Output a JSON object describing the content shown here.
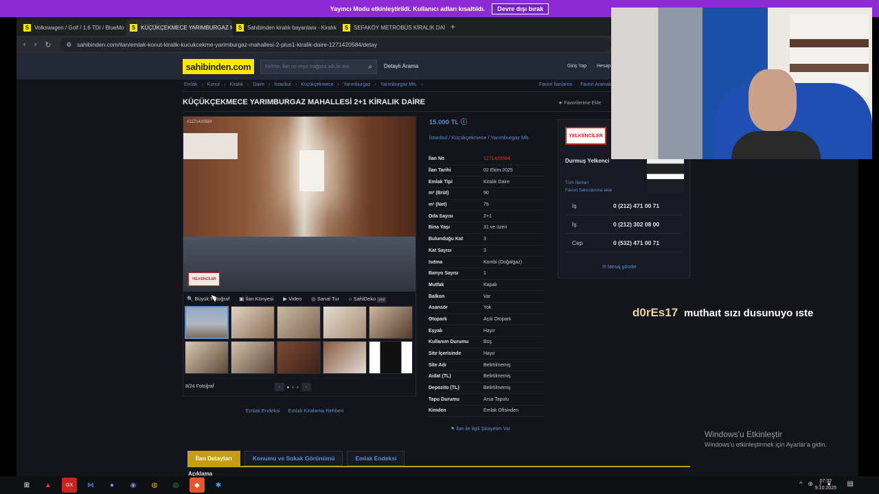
{
  "banner": {
    "text": "Yayıncı Modu etkinleştirildi. Kullanıcı adları kısaltıldı.",
    "button": "Devre dışı bırak"
  },
  "browser": {
    "tabs": [
      {
        "icon": "S",
        "title": "Volkswagen / Golf / 1.6 TDI / BlueMo"
      },
      {
        "icon": "S",
        "title": "KÜÇÜKÇEKMECE YARIMBURGAZ M"
      },
      {
        "icon": "S",
        "title": "Sahibinden kiralık bayanlara - Kiralık"
      },
      {
        "icon": "S",
        "title": "SEFAKÖY METROBÜS KİRALIK DAİRE"
      }
    ],
    "url": "sahibinden.com/ilan/emlak-konut-kiralik-kucukcekme-yarimburgaz-mahallesi-2-plus1-kiralik-daire-1271420584/detay"
  },
  "header": {
    "logo": "sahibinden.com",
    "search_placeholder": "Kelime, ilan no veya mağaza adı ile ara",
    "detailed_search": "Detaylı Arama",
    "login": "Giriş Yap",
    "account": "Hesap"
  },
  "breadcrumb": [
    "Emlak",
    "Konut",
    "Kiralık",
    "Daire",
    "İstanbul",
    "Küçükçekmece",
    "Yarımburgaz",
    "Yarımburgaz Mh."
  ],
  "fav_links": [
    "Favori İlanlarım",
    "Favori Aramalar"
  ],
  "listing": {
    "title": "KÜÇÜKÇEKMECE YARIMBURGAZ MAHALLESİ 2+1 KİRALIK DAİRE",
    "add_favorite": "Favorilerime Ekle",
    "photo_id": "#1271420584",
    "photo_stamp": "YELKENCİLER",
    "price": "15.000 TL",
    "location": "İstanbul / Küçükçekmece / Yarımburgaz Mh.",
    "media": [
      "Büyük Fotoğraf",
      "İlan Künyesi",
      "Video",
      "Sanal Tur",
      "SahiDeko"
    ],
    "media_new": "yeni",
    "photo_count": "8/24 Fotoğraf",
    "links": [
      "Emlak Endeksi",
      "Emlak Kiralama Rehberi"
    ],
    "specs": [
      {
        "k": "İlan No",
        "v": "1271420584",
        "red": true
      },
      {
        "k": "İlan Tarihi",
        "v": "02 Ekim 2025"
      },
      {
        "k": "Emlak Tipi",
        "v": "Kiralık Daire"
      },
      {
        "k": "m² (Brüt)",
        "v": "90"
      },
      {
        "k": "m² (Net)",
        "v": "75"
      },
      {
        "k": "Oda Sayısı",
        "v": "2+1"
      },
      {
        "k": "Bina Yaşı",
        "v": "31 ve üzeri"
      },
      {
        "k": "Bulunduğu Kat",
        "v": "3"
      },
      {
        "k": "Kat Sayısı",
        "v": "3"
      },
      {
        "k": "Isıtma",
        "v": "Kombi (Doğalgaz)"
      },
      {
        "k": "Banyo Sayısı",
        "v": "1"
      },
      {
        "k": "Mutfak",
        "v": "Kapalı"
      },
      {
        "k": "Balkon",
        "v": "Var"
      },
      {
        "k": "Asansör",
        "v": "Yok"
      },
      {
        "k": "Otopark",
        "v": "Açık Otopark"
      },
      {
        "k": "Eşyalı",
        "v": "Hayır"
      },
      {
        "k": "Kullanım Durumu",
        "v": "Boş"
      },
      {
        "k": "Site İçerisinde",
        "v": "Hayır"
      },
      {
        "k": "Site Adı",
        "v": "Belirtilmemiş"
      },
      {
        "k": "Aidat (TL)",
        "v": "Belirtilmemiş"
      },
      {
        "k": "Depozito (TL)",
        "v": "Belirtilmemiş"
      },
      {
        "k": "Tapu Durumu",
        "v": "Arsa Tapulu"
      },
      {
        "k": "Kimden",
        "v": "Emlak Ofisinden"
      }
    ],
    "complain": "İlan ile İlgili Şikayetim Var"
  },
  "seller": {
    "logo_text": "YELKENCİLER",
    "name": "Durmuş Yelkenci",
    "all_ads": "Tüm İlanları",
    "add_fav_seller": "Favori Satıcılarıma ekle",
    "phones": [
      {
        "label": "İş",
        "number": "0 (212) 471 00 71"
      },
      {
        "label": "İş",
        "number": "0 (212) 302 08 00"
      },
      {
        "label": "Cep",
        "number": "0 (532) 471 00 71"
      }
    ],
    "message": "Mesaj gönder"
  },
  "bottom_tabs": [
    "İlan Detayları",
    "Konumu ve Sokak Görünümü",
    "Emlak Endeksi"
  ],
  "description_heading": "Açıklama",
  "chat": {
    "user": "d0rEs17",
    "message": "muthaıt sızı dusunuyo ıste"
  },
  "windows": {
    "line1": "Windows'u Etkinleştir",
    "line2": "Windows'u etkinleştirmek için Ayarlar'a gidin."
  },
  "clock": {
    "time": "07:32",
    "date": "9.10.2025"
  }
}
